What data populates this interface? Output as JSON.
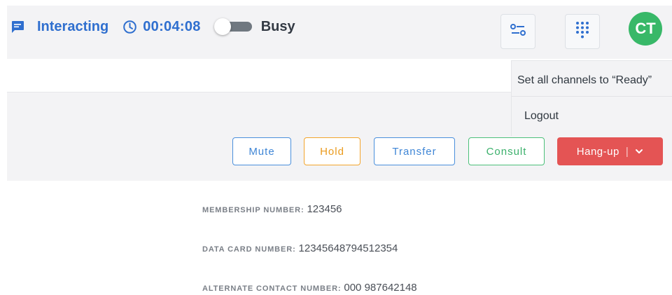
{
  "header": {
    "status_label": "Interacting",
    "timer": "00:04:08",
    "busy_label": "Busy",
    "avatar_initials": "CT",
    "icons": [
      "chat-icon",
      "clock-icon",
      "settings-sliders-icon",
      "dialpad-icon"
    ]
  },
  "menu": {
    "items": [
      {
        "label": "Set all channels to “Ready”"
      },
      {
        "label": "Logout"
      }
    ]
  },
  "actions": {
    "mute": "Mute",
    "hold": "Hold",
    "transfer": "Transfer",
    "consult": "Consult",
    "hangup": "Hang-up",
    "hangup_separator": "|"
  },
  "details": [
    {
      "label": "Membership Number:",
      "value": "123456"
    },
    {
      "label": "Data Card Number:",
      "value": "12345648794512354"
    },
    {
      "label": "Alternate Contact Number:",
      "value": "000  987642148"
    }
  ],
  "colors": {
    "primary": "#2f6fcf",
    "hold": "#f3a52c",
    "consult": "#4cc07a",
    "hangup": "#e45454",
    "avatar": "#38b868"
  }
}
